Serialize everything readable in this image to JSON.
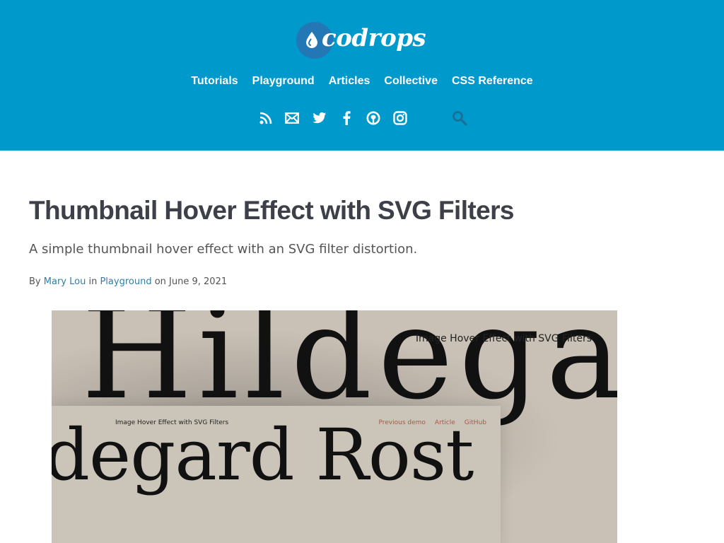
{
  "site": {
    "logo_text": "codrops",
    "nav": [
      "Tutorials",
      "Playground",
      "Articles",
      "Collective",
      "CSS Reference"
    ],
    "social_icons": [
      "rss-icon",
      "mail-icon",
      "twitter-icon",
      "facebook-icon",
      "github-icon",
      "instagram-icon"
    ],
    "search_icon": "search-icon",
    "colors": {
      "header_bg": "#0099cc",
      "link": "#2f7fa5",
      "title": "#3d4048"
    }
  },
  "article": {
    "title": "Thumbnail Hover Effect with SVG Filters",
    "subtitle": "A simple thumbnail hover effect with an SVG filter distortion.",
    "byline": {
      "by": "By",
      "author": "Mary Lou",
      "in": "in",
      "category": "Playground",
      "on": "on June 9, 2021"
    }
  },
  "hero": {
    "big_word": "Hildegar",
    "caption": "Image Hover Effect with SVG Filters",
    "inner": {
      "caption": "Image Hover Effect with SVG Filters",
      "links": [
        "Previous demo",
        "Article",
        "GitHub"
      ],
      "word": "degard Rost"
    }
  }
}
